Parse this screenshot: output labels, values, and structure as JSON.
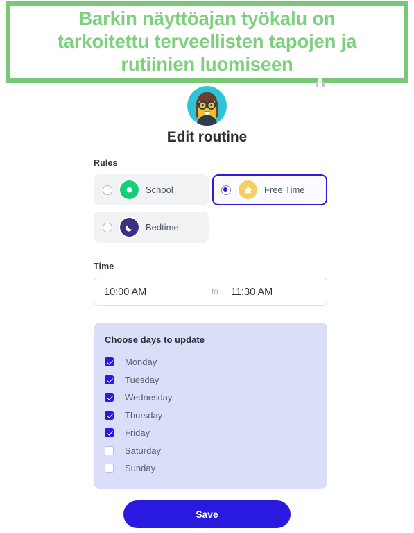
{
  "banner": {
    "text": "Barkin näyttöajan työkalu on\ntarkoitettu terveellisten tapojen ja\nrutiinien luomiseen",
    "border_color": "#78c878",
    "text_color": "#7ed07e"
  },
  "avatar": {
    "icon": "girl-avatar-icon",
    "background_color": "#2ec4d8"
  },
  "header": {
    "title": "Edit routine"
  },
  "rules": {
    "label": "Rules",
    "selected": "Free Time",
    "options": [
      {
        "label": "School",
        "icon": "apple-icon",
        "icon_color": "#13cf7a",
        "checked": false
      },
      {
        "label": "Free Time",
        "icon": "star-icon",
        "icon_color": "#f6cf64",
        "checked": true
      },
      {
        "label": "Bedtime",
        "icon": "moon-icon",
        "icon_color": "#3b2f86",
        "checked": false
      }
    ]
  },
  "time": {
    "label": "Time",
    "start": "10:00 AM",
    "separator": "to",
    "end": "11:30 AM"
  },
  "days": {
    "title": "Choose days to update",
    "panel_color": "#dadef8",
    "items": [
      {
        "label": "Monday",
        "checked": true
      },
      {
        "label": "Tuesday",
        "checked": true
      },
      {
        "label": "Wednesday",
        "checked": true
      },
      {
        "label": "Thursday",
        "checked": true
      },
      {
        "label": "Friday",
        "checked": true
      },
      {
        "label": "Saturday",
        "checked": false
      },
      {
        "label": "Sunday",
        "checked": false
      }
    ]
  },
  "footer": {
    "save_label": "Save",
    "accent_color": "#2a1ae0"
  }
}
